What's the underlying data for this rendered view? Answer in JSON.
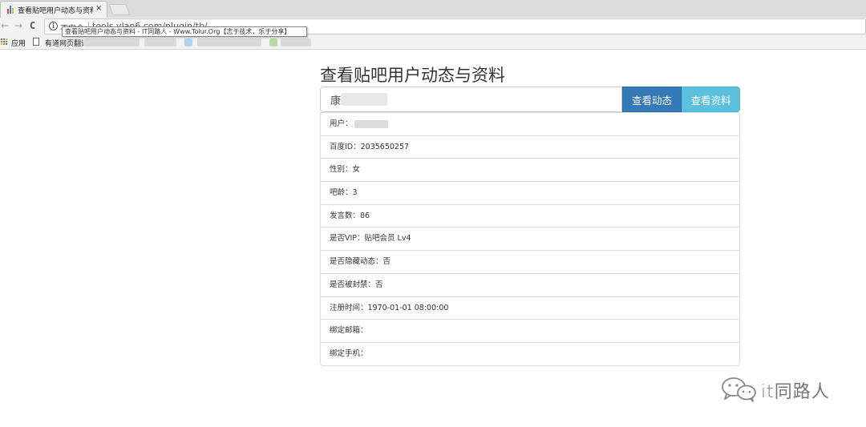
{
  "browser": {
    "tab_title": "查看贴吧用户动态与资料",
    "tab_close": "×",
    "insecure_label": "不安全",
    "url": "tools.ylan6.com/plugin/tb/",
    "tooltip": "查看贴吧用户动态与资料 - IT同路人 - Www.Tolur.Org【志于技术，乐于分享】",
    "bookmarks": {
      "apps_label": "应用",
      "youdao_label": "有道网页翻译"
    },
    "nav": {
      "back": "←",
      "forward": "→",
      "reload": "C"
    }
  },
  "page": {
    "title": "查看贴吧用户动态与资料",
    "search_value": "康",
    "buttons": {
      "dynamics": "查看动态",
      "profile": "查看资料"
    },
    "info_rows": [
      {
        "label": "用户：",
        "value": ""
      },
      {
        "label": "百度ID：",
        "value": "2035650257"
      },
      {
        "label": "性别：",
        "value": "女"
      },
      {
        "label": "吧龄：",
        "value": "3"
      },
      {
        "label": "发言数：",
        "value": "86"
      },
      {
        "label": "是否VIP：",
        "value": "贴吧会员 Lv4"
      },
      {
        "label": "是否隐藏动态：",
        "value": "否"
      },
      {
        "label": "是否被封禁：",
        "value": "否"
      },
      {
        "label": "注册时间：",
        "value": "1970-01-01 08:00:00"
      },
      {
        "label": "绑定邮箱：",
        "value": ""
      },
      {
        "label": "绑定手机：",
        "value": ""
      }
    ]
  },
  "watermark": {
    "text": "it同路人",
    "icon": "wechat-icon"
  },
  "colors": {
    "primary": "#337ab7",
    "info": "#5bc0de",
    "border": "#dddddd"
  }
}
